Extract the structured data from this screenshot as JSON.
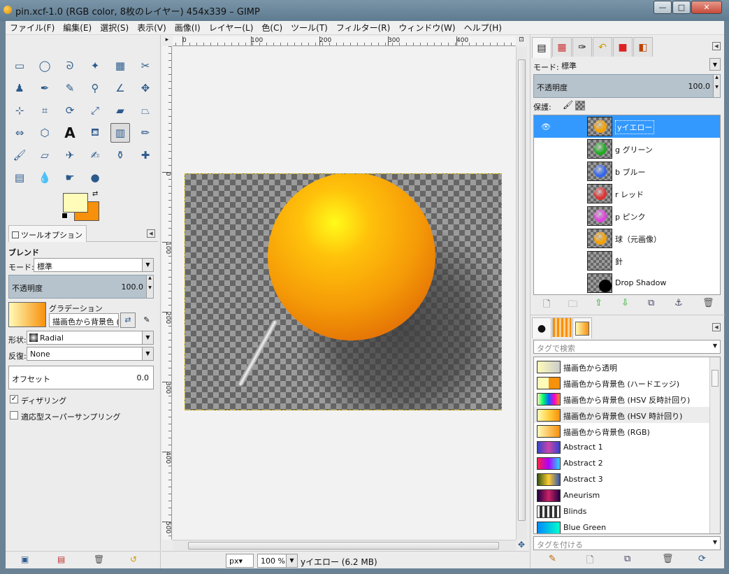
{
  "window": {
    "title": "pin.xcf-1.0 (RGB color, 8枚のレイヤー) 454x339 – GIMP",
    "minimize_label": "—",
    "maximize_label": "□",
    "close_label": "✕",
    "close_color": "#c74a3a"
  },
  "menu": [
    "ファイル(F)",
    "編集(E)",
    "選択(S)",
    "表示(V)",
    "画像(I)",
    "レイヤー(L)",
    "色(C)",
    "ツール(T)",
    "フィルター(R)",
    "ウィンドウ(W)",
    "ヘルプ(H)"
  ],
  "toolbox": {
    "tools": [
      {
        "name": "rect-select-icon",
        "glyph": "▭"
      },
      {
        "name": "ellipse-select-icon",
        "glyph": "◯"
      },
      {
        "name": "free-select-icon",
        "glyph": "ᘐ"
      },
      {
        "name": "fuzzy-select-icon",
        "glyph": "✦"
      },
      {
        "name": "color-select-icon",
        "glyph": "▦"
      },
      {
        "name": "scissors-icon",
        "glyph": "✂"
      },
      {
        "name": "foreground-select-icon",
        "glyph": "♟"
      },
      {
        "name": "paths-icon",
        "glyph": "✒"
      },
      {
        "name": "color-picker-icon",
        "glyph": "✎"
      },
      {
        "name": "zoom-icon",
        "glyph": "⚲"
      },
      {
        "name": "measure-icon",
        "glyph": "∠"
      },
      {
        "name": "move-icon",
        "glyph": "✥"
      },
      {
        "name": "align-icon",
        "glyph": "⊹"
      },
      {
        "name": "crop-icon",
        "glyph": "⌗"
      },
      {
        "name": "rotate-icon",
        "glyph": "⟳"
      },
      {
        "name": "scale-icon",
        "glyph": "⤢"
      },
      {
        "name": "shear-icon",
        "glyph": "▰"
      },
      {
        "name": "perspective-icon",
        "glyph": "⏢"
      },
      {
        "name": "flip-icon",
        "glyph": "⇔"
      },
      {
        "name": "cage-icon",
        "glyph": "⬡"
      },
      {
        "name": "text-icon",
        "glyph": "A"
      },
      {
        "name": "bucket-fill-icon",
        "glyph": "⛾"
      },
      {
        "name": "blend-icon",
        "glyph": "▥"
      },
      {
        "name": "pencil-icon",
        "glyph": "✏"
      },
      {
        "name": "paintbrush-icon",
        "glyph": "🖌"
      },
      {
        "name": "eraser-icon",
        "glyph": "▱"
      },
      {
        "name": "airbrush-icon",
        "glyph": "✈"
      },
      {
        "name": "ink-icon",
        "glyph": "✍"
      },
      {
        "name": "clone-icon",
        "glyph": "⚱"
      },
      {
        "name": "heal-icon",
        "glyph": "✚"
      },
      {
        "name": "perspective-clone-icon",
        "glyph": "▤"
      },
      {
        "name": "blur-icon",
        "glyph": "💧"
      },
      {
        "name": "smudge-icon",
        "glyph": "☛"
      },
      {
        "name": "dodge-burn-icon",
        "glyph": "●"
      }
    ],
    "fg_color": "#fffbb8",
    "bg_color": "#f7900b"
  },
  "tool_options": {
    "tab_label": "ツールオプション",
    "section_title": "ブレンド",
    "mode_label": "モード:",
    "mode_value": "標準",
    "opacity_label": "不透明度",
    "opacity_value": "100.0",
    "gradient_label": "グラデーション",
    "gradient_value": "描画色から背景色 (H",
    "shape_label": "形状:",
    "shape_value": "Radial",
    "repeat_label": "反復:",
    "repeat_value": "None",
    "offset_label": "オフセット",
    "offset_value": "0.0",
    "dither_label": "ディザリング",
    "dither_checked": "✓",
    "supersample_label": "適応型スーパーサンプリング"
  },
  "rulers": {
    "h_ticks": [
      "0",
      "100",
      "200",
      "300",
      "400"
    ],
    "v_ticks": [
      "0",
      "100",
      "200",
      "300",
      "400",
      "500"
    ]
  },
  "status": {
    "unit": "px▾",
    "zoom": "100 %",
    "info": "yイエロー (6.2 MB)"
  },
  "layers": {
    "mode_label": "モード:",
    "mode_value": "標準",
    "opacity_label": "不透明度",
    "opacity_value": "100.0",
    "lock_label": "保護:",
    "items": [
      {
        "name": "yイエロー",
        "color": "#f5a000",
        "selected": true
      },
      {
        "name": "g グリーン",
        "color": "#22aa22"
      },
      {
        "name": "b ブルー",
        "color": "#3366ee"
      },
      {
        "name": "r レッド",
        "color": "#dd3333"
      },
      {
        "name": "p ピンク",
        "color": "#dd44dd"
      },
      {
        "name": "球（元画像）",
        "color": "#f5a000"
      },
      {
        "name": "針",
        "color": ""
      },
      {
        "name": "Drop Shadow",
        "color": "#000000"
      }
    ],
    "eye_glyph": "👁"
  },
  "gradients": {
    "search_placeholder": "タグで検索",
    "tag_placeholder": "タグを付ける",
    "items": [
      {
        "name": "描画色から透明",
        "css": "linear-gradient(90deg,#fffbb8,rgba(255,251,184,0))"
      },
      {
        "name": "描画色から背景色 (ハードエッジ)",
        "css": "linear-gradient(90deg,#fffbb8 50%,#f7900b 50%)"
      },
      {
        "name": "描画色から背景色 (HSV 反時計回り)",
        "css": "linear-gradient(90deg,#fffbb8,#00ff66,#0066ff,#ff00cc,#f7900b)"
      },
      {
        "name": "描画色から背景色 (HSV 時計回り)",
        "css": "linear-gradient(90deg,#fffbb8,#ffd040,#f7900b)"
      },
      {
        "name": "描画色から背景色 (RGB)",
        "css": "linear-gradient(90deg,#fffbb8,#f7900b)"
      },
      {
        "name": "Abstract 1",
        "css": "linear-gradient(90deg,#3344cc,#cc44aa,#3344cc)"
      },
      {
        "name": "Abstract 2",
        "css": "linear-gradient(90deg,#ff2244,#aa00ff,#22ddff)"
      },
      {
        "name": "Abstract 3",
        "css": "linear-gradient(90deg,#335511,#ffcc33,#3355aa)"
      },
      {
        "name": "Aneurism",
        "css": "linear-gradient(90deg,#220044,#cc2266,#220044)"
      },
      {
        "name": "Blinds",
        "css": "repeating-linear-gradient(90deg,#fff 0 3px,#333 3px 7px)"
      },
      {
        "name": "Blue Green",
        "css": "linear-gradient(90deg,#0088ff,#00ffcc)"
      }
    ]
  }
}
